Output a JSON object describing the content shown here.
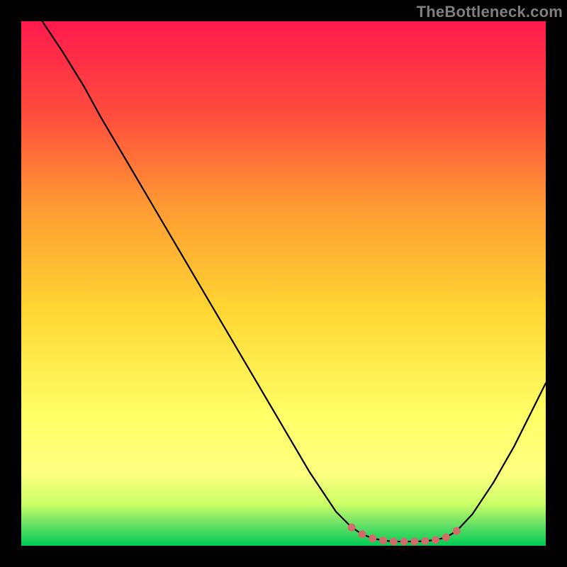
{
  "attribution": "TheBottleneck.com",
  "colors": {
    "black": "#000000",
    "curve": "#000000",
    "dots": "#d46a6a",
    "grad_top": "#ff1a4d",
    "grad_upper_mid": "#ff7a33",
    "grad_mid": "#ffd633",
    "grad_lower_mid": "#ffff66",
    "grad_green_light": "#b3ff66",
    "grad_green": "#33e066",
    "grad_bottom": "#00cc55"
  },
  "chart_data": {
    "type": "line",
    "title": "",
    "xlabel": "",
    "ylabel": "",
    "xlim": [
      0,
      100
    ],
    "ylim": [
      0,
      100
    ],
    "series": [
      {
        "name": "bottleneck-curve",
        "x": [
          4,
          8,
          12,
          15,
          20,
          25,
          30,
          35,
          40,
          45,
          50,
          55,
          60,
          63,
          65,
          67,
          69,
          71,
          73,
          75,
          77,
          79,
          81,
          83,
          86,
          90,
          94,
          98,
          100
        ],
        "y": [
          100,
          94,
          87.5,
          82,
          73.5,
          65,
          56.5,
          48,
          39.5,
          31,
          22.5,
          14,
          6.5,
          3.5,
          2.2,
          1.4,
          1.0,
          0.8,
          0.8,
          0.8,
          0.9,
          1.1,
          1.6,
          2.8,
          6,
          12,
          19,
          27,
          31
        ]
      }
    ],
    "highlight_dots": {
      "name": "trough-dots",
      "x": [
        63,
        65,
        67,
        69,
        71,
        73,
        75,
        77,
        79,
        81,
        83
      ],
      "y": [
        3.5,
        2.2,
        1.4,
        1.0,
        0.8,
        0.8,
        0.8,
        0.9,
        1.1,
        1.6,
        2.8
      ]
    },
    "background_gradient": "vertical red→orange→yellow→green"
  }
}
